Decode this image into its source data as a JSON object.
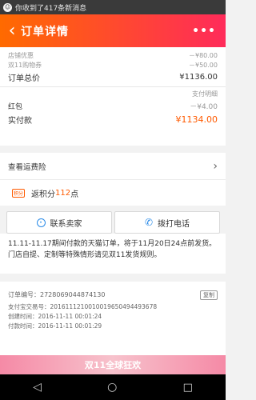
{
  "status_bar": {
    "notification": "你收到了417条新消息"
  },
  "header": {
    "title": "订单详情",
    "more": "•••"
  },
  "costs": {
    "rows": [
      {
        "label": "店铺优惠",
        "value": "－¥80.00"
      },
      {
        "label": "双11购物券",
        "value": "－¥50.00"
      }
    ],
    "total_label": "订单总价",
    "total_value": "¥1136.00",
    "payment_detail_label": "支付明细",
    "red_packet_label": "红包",
    "red_packet_value": "－¥4.00",
    "paid_label": "实付款",
    "paid_value": "¥1134.00"
  },
  "logistics": {
    "label": "查看运费险"
  },
  "points": {
    "icon_text": "积分",
    "prefix": "返积分",
    "amount": "112",
    "suffix": "点"
  },
  "actions": {
    "contact_seller": "联系卖家",
    "call": "拨打电话"
  },
  "notice": {
    "text": "11.11-11.17期间付款的天猫订单，将于11月20日24点前发货。门店自提、定制等特殊情形请见双11发货规则。"
  },
  "order_info": {
    "order_no_label": "订单编号：",
    "order_no": "2728069044874130",
    "copy_label": "复制",
    "alipay_label": "支付宝交易号：",
    "alipay_no": "2016111210010019650494493678",
    "created_label": "创建时间：",
    "created": "2016-11-11 00:01:24",
    "paid_label": "付款时间：",
    "paid": "2016-11-11 00:01:29"
  },
  "banner": {
    "text": "双11全球狂欢"
  },
  "colors": {
    "accent": "#ff5a00",
    "header_start": "#ff6a00",
    "header_end": "#ff2b5a"
  }
}
